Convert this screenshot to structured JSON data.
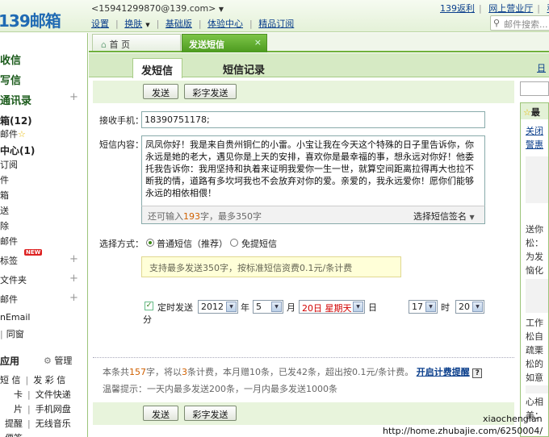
{
  "header": {
    "logo": "139邮箱",
    "account": "<15941299870@139.com>",
    "menu": [
      "设置",
      "换肤",
      "基础版",
      "体验中心",
      "精品订阅"
    ],
    "top_links": [
      "139返利",
      "网上营业厅",
      "积分"
    ],
    "search_placeholder": "邮件搜索..."
  },
  "sidebar": {
    "big_items": [
      "收信",
      "写信",
      "通讯录"
    ],
    "items": [
      "箱(12)",
      "邮件",
      "中心(1)",
      "订阅",
      "件",
      "箱",
      "送",
      "除",
      "邮件"
    ],
    "tags_label": "标签",
    "new_badge": "NEW",
    "files_label": "文件夹",
    "proxy_label": "邮件",
    "email_label": "nEmail",
    "sync_label": "同窗",
    "apps_title": "应用",
    "manage_label": "管理",
    "app_grid": [
      [
        "短 信",
        "发 彩 信"
      ],
      [
        "卡",
        "文件快递"
      ],
      [
        "片",
        "手机网盘"
      ],
      [
        "提醒",
        "无线音乐"
      ],
      [
        "便签",
        ""
      ]
    ]
  },
  "tabs": {
    "home": "首 页",
    "sms": "发送短信",
    "sms_close": "×"
  },
  "subtabs": {
    "send": "发短信",
    "record": "短信记录",
    "right": "日"
  },
  "form": {
    "send_button": "发送",
    "mms_button": "彩字发送",
    "receiver_label": "接收手机：",
    "receiver_value": "18390751178;",
    "content_label": "短信内容：",
    "content_text": "凤凤你好！我是来自贵州铜仁的小雷。小宝让我在今天这个特殊的日子里告诉你，你永远是她的老大，遇见你是上天的安排，喜欢你是最幸福的事，想永远对你好！他委托我告诉你：我用坚持和执着来证明我爱你一生一世，就算空间距离拉得再大也拉不断我的情，道路有多坎坷我也不会放弃对你的爱。亲爱的，我永远爱你！愿你们能够永远的相依相偎！",
    "counter_prefix": "还可输入",
    "counter_value": "193",
    "counter_suffix": "字，最多350字",
    "signature_label": "选择短信签名",
    "mode_label": "选择方式：",
    "mode_normal": "普通短信（推荐）",
    "mode_free": "免提短信",
    "tip_text": "支持最多发送350字，按标准短信资费0.1元/条计费",
    "timed_label": "定时发送",
    "year": "2012",
    "year_unit": "年",
    "month": "5",
    "month_unit": "月",
    "day": "20日 星期天",
    "day_unit": "日",
    "hour": "17",
    "hour_unit": "时",
    "minute": "20",
    "minute_unit": "分"
  },
  "stats": {
    "p1": "本条共",
    "chars": "157",
    "p2": "字，将以",
    "count": "3",
    "p3": "条计费，本月赠10条，已发42条，超出按0.1元/条计费。",
    "link": "开启计费提醒",
    "help": "?",
    "reminder": "温馨提示：一天内最多发送200条，一月内最多发送1000条"
  },
  "right_panel": {
    "head": "最",
    "link1": "关闭",
    "link2": "警惠",
    "lines": [
      "送你",
      "松：",
      "为发",
      "恼化",
      "工作",
      "松自",
      "疏栗",
      "松的",
      "如意",
      "心相",
      "美："
    ]
  },
  "watermark": {
    "author": "xiaochenglan",
    "url": "http://home.zhubajie.com/6250004/"
  }
}
